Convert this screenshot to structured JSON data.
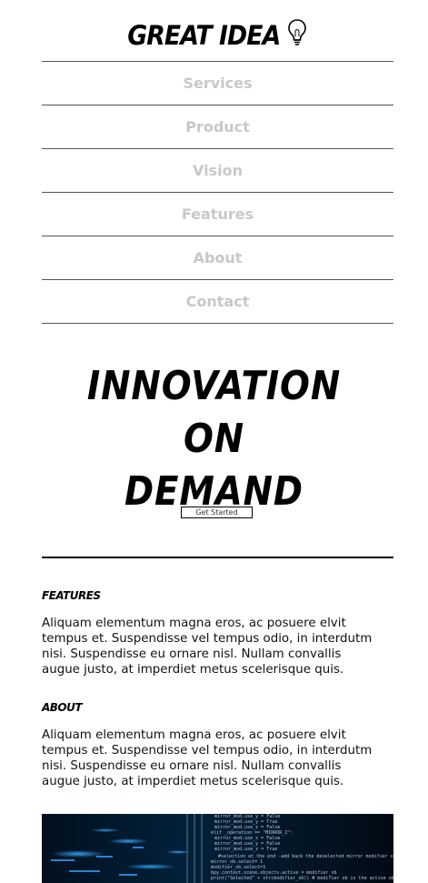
{
  "logo": {
    "text": "GREAT IDEA",
    "icon": "lightbulb-icon"
  },
  "nav": {
    "items": [
      {
        "label": "Services"
      },
      {
        "label": "Product"
      },
      {
        "label": "Vision"
      },
      {
        "label": "Features"
      },
      {
        "label": "About"
      },
      {
        "label": "Contact"
      }
    ]
  },
  "hero": {
    "line1": "INNOVATION",
    "line2": "ON",
    "line3": "DEMAND",
    "cta_label": "Get Started"
  },
  "features": {
    "title": "FEATURES",
    "body": "Aliquam elementum magna eros, ac posuere elvit tempus et. Suspendisse vel tempus odio, in interdutm nisi. Suspendisse eu ornare nisl. Nullam convallis augue justo, at imperdiet metus scelerisque quis."
  },
  "about": {
    "title": "ABOUT",
    "body": "Aliquam elementum magna eros, ac posuere elvit tempus et. Suspendisse vel tempus odio, in interdutm nisi. Suspendisse eu ornare nisl. Nullam convallis augue justo, at imperdiet metus scelerisque quis."
  },
  "image": {
    "icon": "code-screenshot-image"
  },
  "colors": {
    "nav_text": "#c8c8c8",
    "divider": "#000000",
    "image_glow": "#1e90ff"
  }
}
